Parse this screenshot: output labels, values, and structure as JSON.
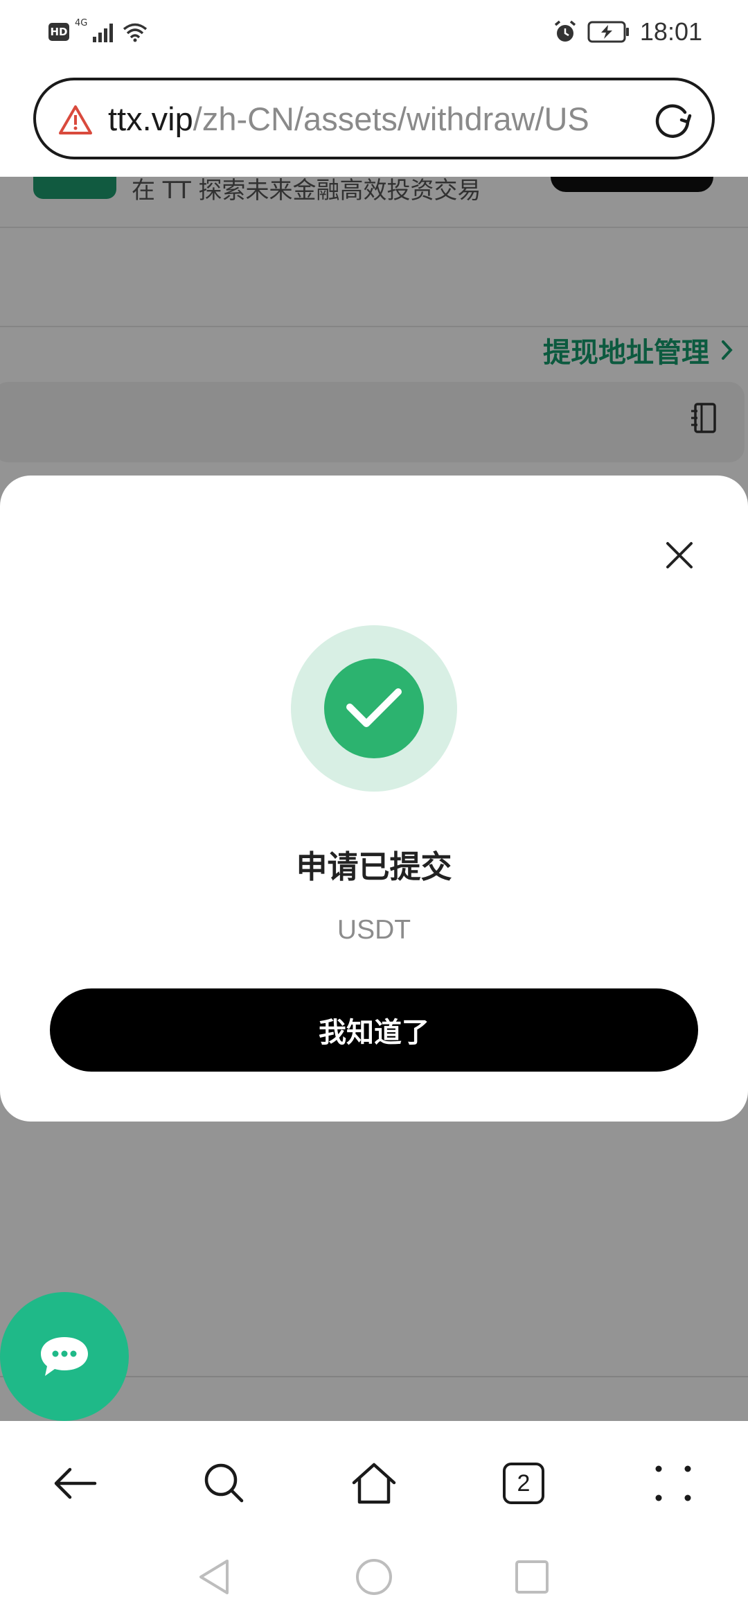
{
  "status_bar": {
    "hd_badge": "HD",
    "network": "4G",
    "time": "18:01",
    "icons": [
      "hd-icon",
      "signal-icon",
      "wifi-icon",
      "alarm-icon",
      "battery-charging-icon"
    ]
  },
  "browser": {
    "url_host": "ttx.vip",
    "url_path": "/zh-CN/assets/withdraw/US",
    "warning_icon": "warning-triangle-icon",
    "reload_icon": "reload-icon",
    "tab_count": "2",
    "toolbar_icons": [
      "back-arrow-icon",
      "search-icon",
      "home-icon",
      "tabs-icon",
      "more-dots-icon"
    ]
  },
  "page": {
    "promo_text": "在 TT 探索未来金融高效投资交易",
    "withdraw_address_link": "提现地址管理",
    "address_book_icon": "address-book-icon"
  },
  "modal": {
    "title": "申请已提交",
    "subtitle": "USDT",
    "confirm_label": "我知道了",
    "colors": {
      "success": "#2cb36f",
      "success_ring": "#d8efe4",
      "button": "#000000"
    }
  },
  "brand": {
    "accent": "#159b6d",
    "chat_fab": "#1fb988"
  }
}
